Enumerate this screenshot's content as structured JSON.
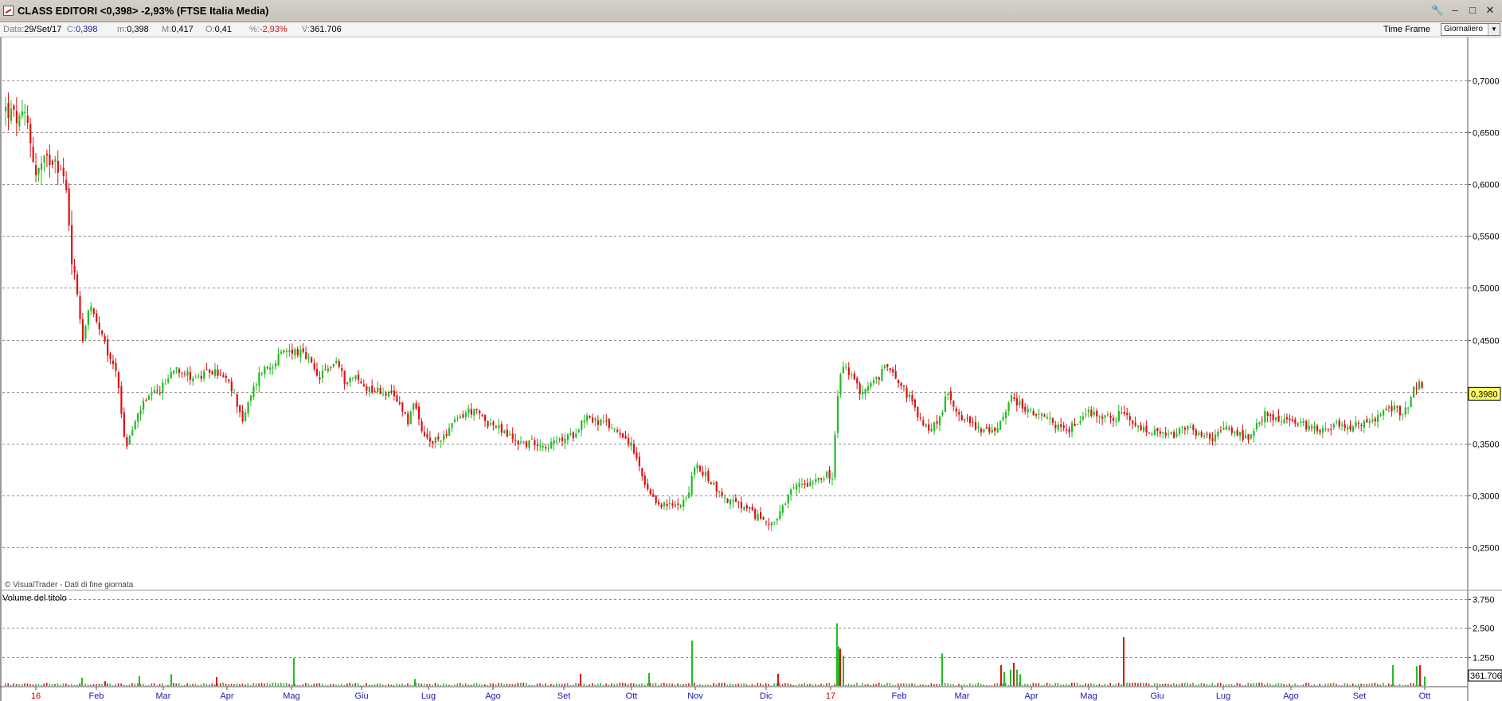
{
  "window": {
    "title": "CLASS EDITORI <0,398> -2,93%  (FTSE Italia Media)",
    "buttons": [
      "🔧",
      "–",
      "□",
      "✕"
    ]
  },
  "info": {
    "date_label": "Data:",
    "date_value": "29/Set/17",
    "close_label": "C:",
    "close_value": "0,398",
    "min_label": "m:",
    "min_value": "0,398",
    "max_label": "M:",
    "max_value": "0,417",
    "open_label": "O:",
    "open_value": "0,41",
    "pct_label": "%:",
    "pct_value": "-2,93%",
    "vol_label": "V:",
    "vol_value": "361.706",
    "timeframe_label": "Time Frame",
    "timeframe_value": "Giornaliero"
  },
  "copyright": "© VisualTrader - Dati di fine giornata",
  "volume_title": "Volume del titolo",
  "colors": {
    "up": "#22bb22",
    "down": "#dd1111",
    "grid": "#8f8f8f",
    "last_price_bg": "#ffff66"
  },
  "chart_data": {
    "type": "candlestick",
    "series_up_color": "#22bb22",
    "series_down_color": "#dd1111",
    "price_axis": {
      "ylim": [
        0.2094,
        0.7414
      ],
      "ticks": [
        "0,7000",
        "0,6500",
        "0,6000",
        "0,5500",
        "0,5000",
        "0,4500",
        "0,4000",
        "0,3500",
        "0,3000",
        "0,2500"
      ]
    },
    "last_price_label": "0,3980",
    "volume_axis": {
      "ticks": [
        "3.750",
        "2.500",
        "1.250"
      ],
      "last_volume_label": "361.706"
    },
    "x_labels": [
      {
        "text": "16",
        "year": true
      },
      {
        "text": "Feb"
      },
      {
        "text": "Mar"
      },
      {
        "text": "Apr"
      },
      {
        "text": "Mag"
      },
      {
        "text": "Giu"
      },
      {
        "text": "Lug"
      },
      {
        "text": "Ago"
      },
      {
        "text": "Set"
      },
      {
        "text": "Ott"
      },
      {
        "text": "Nov"
      },
      {
        "text": "Dic"
      },
      {
        "text": "17",
        "year": true
      },
      {
        "text": "Feb"
      },
      {
        "text": "Mar"
      },
      {
        "text": "Apr"
      },
      {
        "text": "Mag"
      },
      {
        "text": "Giu"
      },
      {
        "text": "Lug"
      },
      {
        "text": "Ago"
      },
      {
        "text": "Set"
      },
      {
        "text": "Ott"
      }
    ],
    "price_path": [
      [
        0,
        0.672
      ],
      [
        18,
        0.66
      ],
      [
        26,
        0.665
      ],
      [
        38,
        0.61
      ],
      [
        48,
        0.62
      ],
      [
        62,
        0.628
      ],
      [
        75,
        0.6
      ],
      [
        80,
        0.56
      ],
      [
        84,
        0.52
      ],
      [
        90,
        0.495
      ],
      [
        97,
        0.45
      ],
      [
        105,
        0.485
      ],
      [
        112,
        0.47
      ],
      [
        120,
        0.455
      ],
      [
        130,
        0.432
      ],
      [
        140,
        0.42
      ],
      [
        150,
        0.345
      ],
      [
        160,
        0.365
      ],
      [
        170,
        0.385
      ],
      [
        182,
        0.395
      ],
      [
        192,
        0.4
      ],
      [
        202,
        0.41
      ],
      [
        212,
        0.425
      ],
      [
        222,
        0.42
      ],
      [
        232,
        0.415
      ],
      [
        244,
        0.413
      ],
      [
        256,
        0.42
      ],
      [
        266,
        0.418
      ],
      [
        278,
        0.41
      ],
      [
        288,
        0.395
      ],
      [
        298,
        0.372
      ],
      [
        310,
        0.4
      ],
      [
        320,
        0.42
      ],
      [
        333,
        0.425
      ],
      [
        345,
        0.435
      ],
      [
        357,
        0.44
      ],
      [
        369,
        0.438
      ],
      [
        381,
        0.43
      ],
      [
        392,
        0.412
      ],
      [
        404,
        0.422
      ],
      [
        415,
        0.43
      ],
      [
        426,
        0.41
      ],
      [
        438,
        0.415
      ],
      [
        450,
        0.405
      ],
      [
        462,
        0.402
      ],
      [
        474,
        0.4
      ],
      [
        486,
        0.395
      ],
      [
        498,
        0.385
      ],
      [
        506,
        0.37
      ],
      [
        512,
        0.392
      ],
      [
        522,
        0.36
      ],
      [
        534,
        0.35
      ],
      [
        546,
        0.355
      ],
      [
        558,
        0.365
      ],
      [
        570,
        0.375
      ],
      [
        582,
        0.382
      ],
      [
        594,
        0.378
      ],
      [
        606,
        0.37
      ],
      [
        618,
        0.365
      ],
      [
        630,
        0.358
      ],
      [
        642,
        0.352
      ],
      [
        654,
        0.35
      ],
      [
        666,
        0.352
      ],
      [
        678,
        0.348
      ],
      [
        690,
        0.35
      ],
      [
        702,
        0.355
      ],
      [
        712,
        0.358
      ],
      [
        722,
        0.37
      ],
      [
        730,
        0.378
      ],
      [
        738,
        0.372
      ],
      [
        750,
        0.37
      ],
      [
        762,
        0.365
      ],
      [
        774,
        0.36
      ],
      [
        784,
        0.35
      ],
      [
        792,
        0.335
      ],
      [
        802,
        0.31
      ],
      [
        812,
        0.295
      ],
      [
        822,
        0.292
      ],
      [
        832,
        0.29
      ],
      [
        842,
        0.29
      ],
      [
        852,
        0.298
      ],
      [
        858,
        0.3
      ],
      [
        864,
        0.33
      ],
      [
        870,
        0.325
      ],
      [
        878,
        0.32
      ],
      [
        888,
        0.312
      ],
      [
        898,
        0.3
      ],
      [
        908,
        0.295
      ],
      [
        918,
        0.292
      ],
      [
        928,
        0.287
      ],
      [
        938,
        0.282
      ],
      [
        948,
        0.278
      ],
      [
        958,
        0.275
      ],
      [
        968,
        0.275
      ],
      [
        978,
        0.29
      ],
      [
        988,
        0.305
      ],
      [
        998,
        0.312
      ],
      [
        1008,
        0.312
      ],
      [
        1018,
        0.318
      ],
      [
        1030,
        0.32
      ],
      [
        1038,
        0.315
      ],
      [
        1044,
        0.39
      ],
      [
        1050,
        0.425
      ],
      [
        1058,
        0.42
      ],
      [
        1066,
        0.408
      ],
      [
        1074,
        0.4
      ],
      [
        1084,
        0.405
      ],
      [
        1094,
        0.412
      ],
      [
        1104,
        0.422
      ],
      [
        1112,
        0.425
      ],
      [
        1120,
        0.412
      ],
      [
        1128,
        0.402
      ],
      [
        1136,
        0.393
      ],
      [
        1144,
        0.378
      ],
      [
        1154,
        0.365
      ],
      [
        1162,
        0.366
      ],
      [
        1172,
        0.372
      ],
      [
        1182,
        0.398
      ],
      [
        1192,
        0.385
      ],
      [
        1202,
        0.375
      ],
      [
        1212,
        0.37
      ],
      [
        1222,
        0.365
      ],
      [
        1232,
        0.362
      ],
      [
        1242,
        0.36
      ],
      [
        1252,
        0.378
      ],
      [
        1262,
        0.393
      ],
      [
        1272,
        0.39
      ],
      [
        1282,
        0.382
      ],
      [
        1292,
        0.378
      ],
      [
        1302,
        0.375
      ],
      [
        1312,
        0.372
      ],
      [
        1322,
        0.366
      ],
      [
        1332,
        0.362
      ],
      [
        1342,
        0.368
      ],
      [
        1352,
        0.378
      ],
      [
        1362,
        0.38
      ],
      [
        1372,
        0.378
      ],
      [
        1382,
        0.376
      ],
      [
        1392,
        0.374
      ],
      [
        1402,
        0.38
      ],
      [
        1412,
        0.37
      ],
      [
        1422,
        0.365
      ],
      [
        1432,
        0.362
      ],
      [
        1442,
        0.36
      ],
      [
        1452,
        0.358
      ],
      [
        1462,
        0.357
      ],
      [
        1472,
        0.36
      ],
      [
        1482,
        0.365
      ],
      [
        1492,
        0.362
      ],
      [
        1502,
        0.357
      ],
      [
        1512,
        0.355
      ],
      [
        1522,
        0.358
      ],
      [
        1532,
        0.365
      ],
      [
        1542,
        0.362
      ],
      [
        1552,
        0.357
      ],
      [
        1562,
        0.352
      ],
      [
        1570,
        0.365
      ],
      [
        1580,
        0.378
      ],
      [
        1590,
        0.375
      ],
      [
        1600,
        0.373
      ],
      [
        1610,
        0.372
      ],
      [
        1620,
        0.37
      ],
      [
        1630,
        0.368
      ],
      [
        1640,
        0.366
      ],
      [
        1650,
        0.364
      ],
      [
        1660,
        0.366
      ],
      [
        1670,
        0.368
      ],
      [
        1680,
        0.368
      ],
      [
        1690,
        0.366
      ],
      [
        1700,
        0.368
      ],
      [
        1710,
        0.37
      ],
      [
        1720,
        0.372
      ],
      [
        1730,
        0.382
      ],
      [
        1740,
        0.385
      ],
      [
        1750,
        0.38
      ],
      [
        1760,
        0.386
      ],
      [
        1768,
        0.402
      ],
      [
        1774,
        0.41
      ],
      [
        1780,
        0.398
      ]
    ],
    "volume_spikes": [
      [
        96,
        350
      ],
      [
        125,
        200
      ],
      [
        168,
        420
      ],
      [
        208,
        500
      ],
      [
        265,
        380
      ],
      [
        362,
        1200
      ],
      [
        514,
        300
      ],
      [
        722,
        520
      ],
      [
        808,
        550
      ],
      [
        862,
        1950
      ],
      [
        970,
        520
      ],
      [
        1044,
        2700
      ],
      [
        1046,
        1700
      ],
      [
        1048,
        1600
      ],
      [
        1052,
        1300
      ],
      [
        1176,
        1400
      ],
      [
        1250,
        900
      ],
      [
        1254,
        600
      ],
      [
        1262,
        700
      ],
      [
        1266,
        1000
      ],
      [
        1270,
        700
      ],
      [
        1274,
        500
      ],
      [
        1404,
        2100
      ],
      [
        1742,
        900
      ],
      [
        1772,
        850
      ],
      [
        1776,
        900
      ],
      [
        1782,
        400
      ]
    ]
  }
}
